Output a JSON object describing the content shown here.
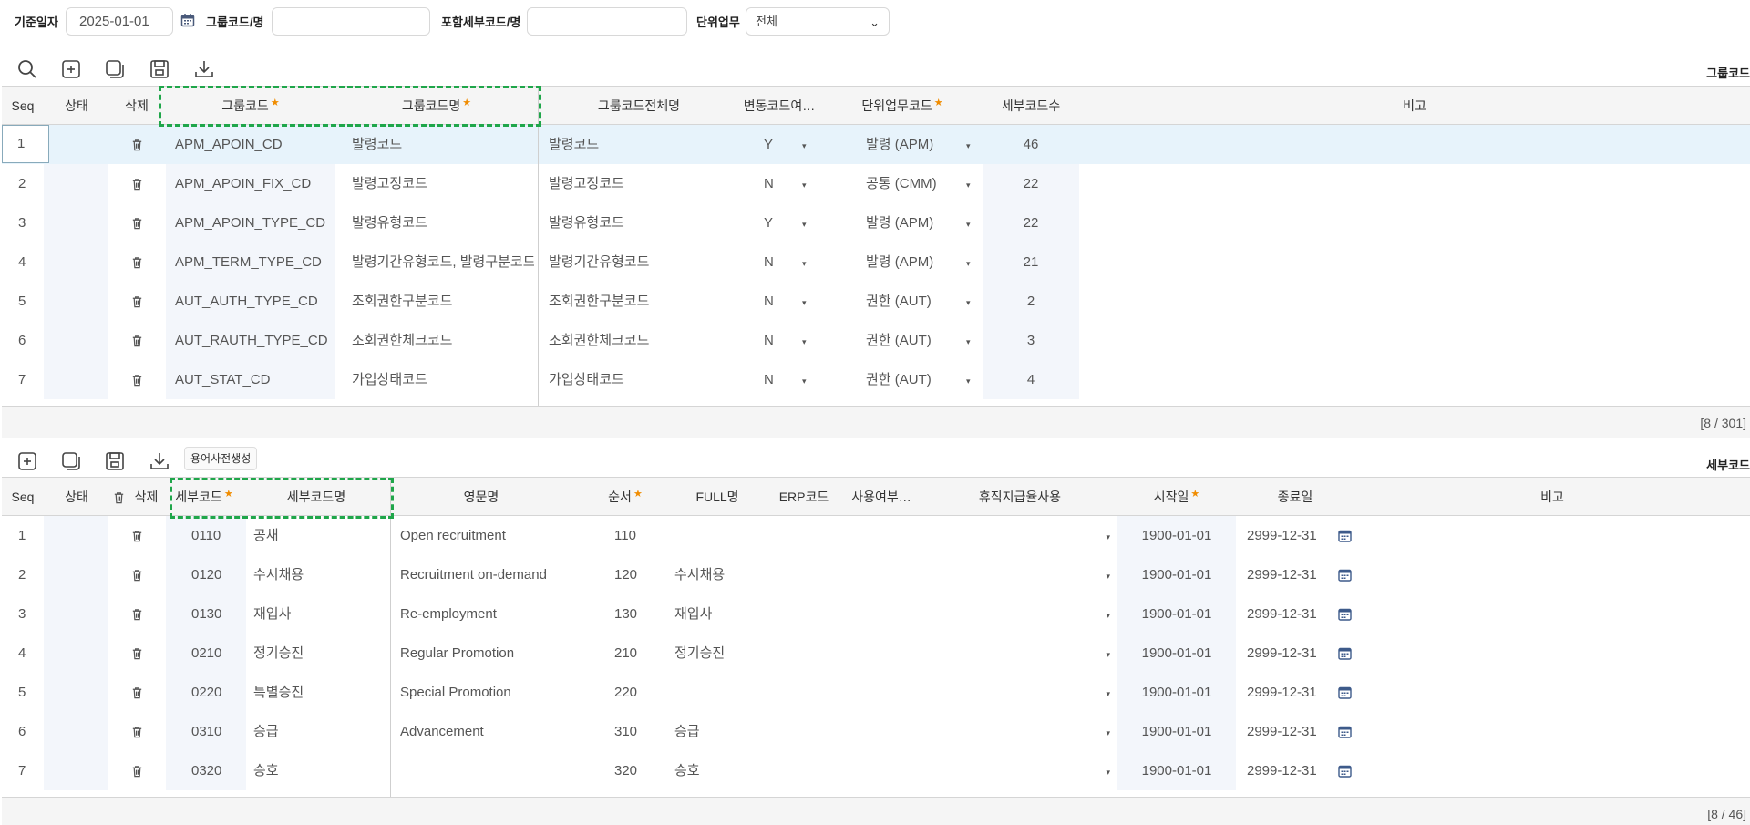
{
  "search": {
    "base_date_label": "기준일자",
    "base_date_value": "2025-01-01",
    "group_code_label": "그룹코드/명",
    "group_code_value": "",
    "detail_code_label": "포함세부코드/명",
    "detail_code_value": "",
    "unit_task_label": "단위업무",
    "unit_task_value": "전체"
  },
  "colors": {
    "required_star": "#f08c00",
    "highlight_dash": "#1fa64a",
    "selected_row": "#e7f3fb",
    "header_bg": "#f5f5f5"
  },
  "group_grid": {
    "right_label": "그룹코드",
    "headers": {
      "seq": "Seq",
      "status": "상태",
      "delete": "삭제",
      "group_code": "그룹코드",
      "group_name": "그룹코드명",
      "full_name": "그룹코드전체명",
      "variable": "변동코드여…",
      "unit_task": "단위업무코드",
      "detail_count": "세부코드수",
      "note": "비고"
    },
    "rows": [
      {
        "seq": "1",
        "code": "APM_APOIN_CD",
        "name": "발령코드",
        "full": "발령코드",
        "var": "Y",
        "unit": "발령 (APM)",
        "count": "46"
      },
      {
        "seq": "2",
        "code": "APM_APOIN_FIX_CD",
        "name": "발령고정코드",
        "full": "발령고정코드",
        "var": "N",
        "unit": "공통 (CMM)",
        "count": "22"
      },
      {
        "seq": "3",
        "code": "APM_APOIN_TYPE_CD",
        "name": "발령유형코드",
        "full": "발령유형코드",
        "var": "Y",
        "unit": "발령 (APM)",
        "count": "22"
      },
      {
        "seq": "4",
        "code": "APM_TERM_TYPE_CD",
        "name": "발령기간유형코드, 발령구분코드",
        "full": "발령기간유형코드",
        "var": "N",
        "unit": "발령 (APM)",
        "count": "21"
      },
      {
        "seq": "5",
        "code": "AUT_AUTH_TYPE_CD",
        "name": "조회권한구분코드",
        "full": "조회권한구분코드",
        "var": "N",
        "unit": "권한 (AUT)",
        "count": "2"
      },
      {
        "seq": "6",
        "code": "AUT_RAUTH_TYPE_CD",
        "name": "조회권한체크코드",
        "full": "조회권한체크코드",
        "var": "N",
        "unit": "권한 (AUT)",
        "count": "3"
      },
      {
        "seq": "7",
        "code": "AUT_STAT_CD",
        "name": "가입상태코드",
        "full": "가입상태코드",
        "var": "N",
        "unit": "권한 (AUT)",
        "count": "4"
      }
    ],
    "footer": "[8 / 301]"
  },
  "detail_grid": {
    "right_label": "세부코드",
    "dict_button": "용어사전생성",
    "headers": {
      "seq": "Seq",
      "status": "상태",
      "delete": "삭제",
      "detail_code": "세부코드",
      "detail_name": "세부코드명",
      "eng_name": "영문명",
      "order": "순서",
      "full_name": "FULL명",
      "erp": "ERP코드",
      "use": "사용여부…",
      "leave_pay": "휴직지급율사용",
      "start": "시작일",
      "end": "종료일",
      "note": "비고"
    },
    "rows": [
      {
        "seq": "1",
        "code": "0110",
        "name": "공채",
        "eng": "Open recruitment",
        "order": "110",
        "full": "",
        "start": "1900-01-01",
        "end": "2999-12-31"
      },
      {
        "seq": "2",
        "code": "0120",
        "name": "수시채용",
        "eng": "Recruitment on-demand",
        "order": "120",
        "full": "수시채용",
        "start": "1900-01-01",
        "end": "2999-12-31"
      },
      {
        "seq": "3",
        "code": "0130",
        "name": "재입사",
        "eng": "Re-employment",
        "order": "130",
        "full": "재입사",
        "start": "1900-01-01",
        "end": "2999-12-31"
      },
      {
        "seq": "4",
        "code": "0210",
        "name": "정기승진",
        "eng": "Regular Promotion",
        "order": "210",
        "full": "정기승진",
        "start": "1900-01-01",
        "end": "2999-12-31"
      },
      {
        "seq": "5",
        "code": "0220",
        "name": "특별승진",
        "eng": "Special Promotion",
        "order": "220",
        "full": "",
        "start": "1900-01-01",
        "end": "2999-12-31"
      },
      {
        "seq": "6",
        "code": "0310",
        "name": "승급",
        "eng": "Advancement",
        "order": "310",
        "full": "승급",
        "start": "1900-01-01",
        "end": "2999-12-31"
      },
      {
        "seq": "7",
        "code": "0320",
        "name": "승호",
        "eng": "",
        "order": "320",
        "full": "승호",
        "start": "1900-01-01",
        "end": "2999-12-31"
      }
    ],
    "footer": "[8 / 46]"
  }
}
